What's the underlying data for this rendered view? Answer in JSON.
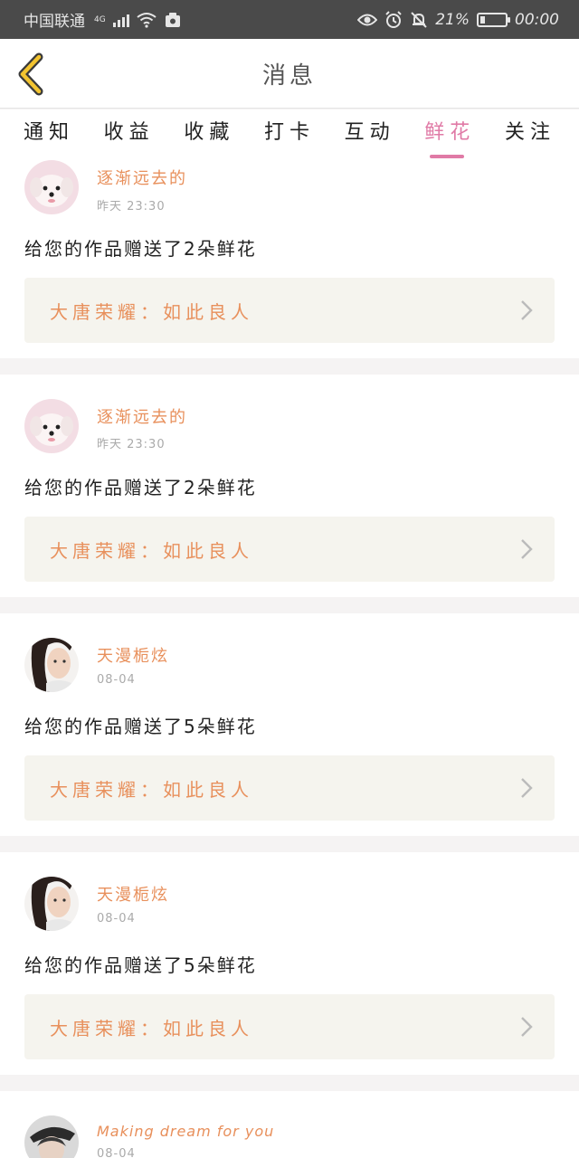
{
  "status_bar": {
    "carrier": "中国联通",
    "network": "4G",
    "battery": "21%",
    "battery_level": 0.21,
    "time": "00:00"
  },
  "header": {
    "title": "消息"
  },
  "tabs": [
    {
      "label": "通知",
      "active": false
    },
    {
      "label": "收益",
      "active": false
    },
    {
      "label": "收藏",
      "active": false
    },
    {
      "label": "打卡",
      "active": false
    },
    {
      "label": "互动",
      "active": false
    },
    {
      "label": "鲜花",
      "active": true
    },
    {
      "label": "关注",
      "active": false
    }
  ],
  "messages": [
    {
      "user": "逐渐远去的",
      "time": "昨天  23:30",
      "text": "给您的作品赠送了2朵鲜花",
      "work": "大唐荣耀：如此良人"
    },
    {
      "user": "逐渐远去的",
      "time": "昨天  23:30",
      "text": "给您的作品赠送了2朵鲜花",
      "work": "大唐荣耀：如此良人"
    },
    {
      "user": "天漫栀炫",
      "time": "08-04",
      "text": "给您的作品赠送了5朵鲜花",
      "work": "大唐荣耀：如此良人"
    },
    {
      "user": "天漫栀炫",
      "time": "08-04",
      "text": "给您的作品赠送了5朵鲜花",
      "work": "大唐荣耀：如此良人"
    },
    {
      "user": "Making dream for you",
      "time": "08-04"
    }
  ],
  "colors": {
    "accent": "#e07aa6",
    "username": "#e8905c",
    "back_icon": "#f3c430"
  }
}
